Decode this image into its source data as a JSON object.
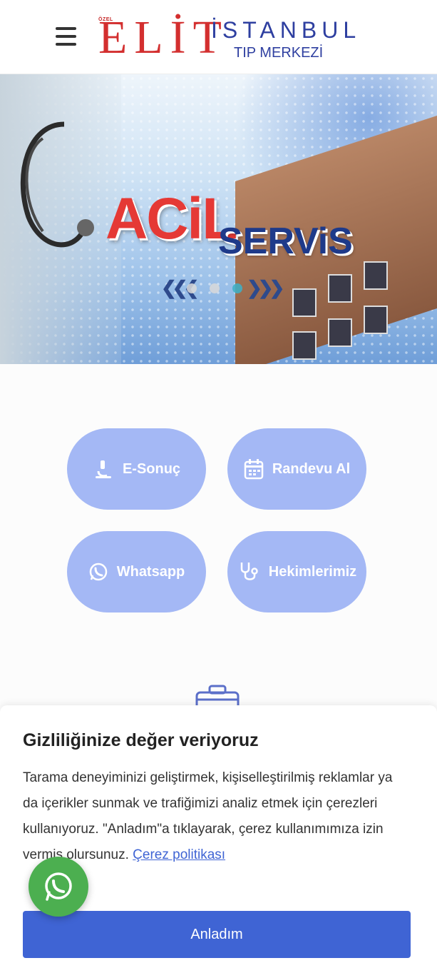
{
  "header": {
    "logo": {
      "ozel": "ÖZEL",
      "elit": "ELİT",
      "istanbul": "İSTANBUL",
      "sub": "TIP MERKEZİ"
    }
  },
  "hero": {
    "headline_red": "ACiL",
    "headline_blue": "SERViS",
    "slides_count": 3,
    "active_slide": 3
  },
  "quick_links": [
    {
      "label": "E-Sonuç",
      "icon": "microscope-icon"
    },
    {
      "label": "Randevu Al",
      "icon": "calendar-icon"
    },
    {
      "label": "Whatsapp",
      "icon": "whatsapp-icon"
    },
    {
      "label": "Hekimlerimiz",
      "icon": "stethoscope-icon"
    }
  ],
  "cookie": {
    "title": "Gizliliğinize değer veriyoruz",
    "body": "Tarama deneyiminizi geliştirmek, kişiselleştirilmiş reklamlar ya da içerikler sunmak ve trafiğimizi analiz etmek için çerezleri kullanıyoruz. \"Anladım\"a tıklayarak, çerez kullanımımıza izin vermiş olursunuz.",
    "link": "Çerez politikası",
    "accept": "Anladım"
  },
  "colors": {
    "brand_red": "#d32f2f",
    "brand_blue": "#2e3fa0",
    "tile_bg": "#a4b8f5",
    "button_blue": "#3f64d4",
    "whatsapp_green": "#4caf50"
  }
}
